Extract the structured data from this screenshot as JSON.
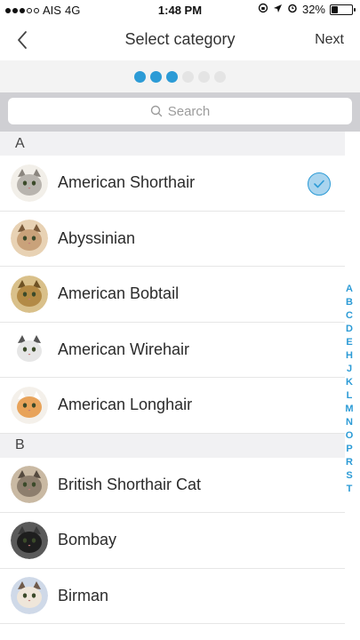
{
  "status_bar": {
    "carrier": "AIS",
    "network": "4G",
    "time": "1:48 PM",
    "battery_percent": "32%",
    "battery_level": 0.32
  },
  "nav": {
    "back_icon": "chevron-left-icon",
    "title": "Select category",
    "next_label": "Next"
  },
  "progress": {
    "total_steps": 6,
    "completed_steps": 3,
    "active_color": "#2c9bd6"
  },
  "search": {
    "placeholder": "Search",
    "icon": "search-icon"
  },
  "sections": [
    {
      "letter": "A",
      "items": [
        {
          "label": "American Shorthair",
          "selected": true
        },
        {
          "label": "Abyssinian",
          "selected": false
        },
        {
          "label": "American Bobtail",
          "selected": false
        },
        {
          "label": "American Wirehair",
          "selected": false
        },
        {
          "label": "American Longhair",
          "selected": false
        }
      ]
    },
    {
      "letter": "B",
      "items": [
        {
          "label": "British Shorthair Cat",
          "selected": false
        },
        {
          "label": "Bombay",
          "selected": false
        },
        {
          "label": "Birman",
          "selected": false
        }
      ]
    }
  ],
  "index_letters": [
    "A",
    "B",
    "C",
    "D",
    "E",
    "H",
    "J",
    "K",
    "L",
    "M",
    "N",
    "O",
    "P",
    "R",
    "S",
    "T"
  ],
  "accent_color": "#2c9bd6"
}
